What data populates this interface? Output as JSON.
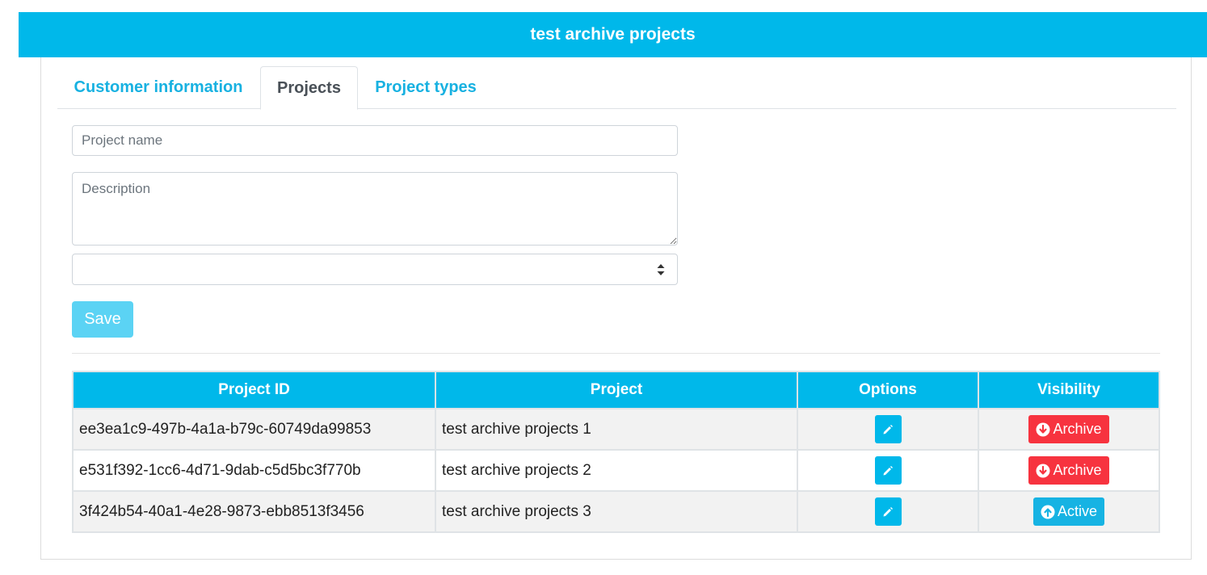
{
  "header": {
    "title": "test archive projects"
  },
  "tabs": [
    {
      "label": "Customer information",
      "active": false
    },
    {
      "label": "Projects",
      "active": true
    },
    {
      "label": "Project types",
      "active": false
    }
  ],
  "form": {
    "project_name_placeholder": "Project name",
    "description_placeholder": "Description",
    "project_type_value": "",
    "save_label": "Save"
  },
  "table": {
    "headers": [
      "Project ID",
      "Project",
      "Options",
      "Visibility"
    ],
    "rows": [
      {
        "id": "ee3ea1c9-497b-4a1a-b79c-60749da99853",
        "project": "test archive projects 1",
        "visibility": "Archive",
        "visibility_icon": "arrow-down-circle-icon",
        "visibility_color": "#f7333f"
      },
      {
        "id": "e531f392-1cc6-4d71-9dab-c5d5bc3f770b",
        "project": "test archive projects 2",
        "visibility": "Archive",
        "visibility_icon": "arrow-down-circle-icon",
        "visibility_color": "#f7333f"
      },
      {
        "id": "3f424b54-40a1-4e28-9873-ebb8513f3456",
        "project": "test archive projects 3",
        "visibility": "Active",
        "visibility_icon": "arrow-up-circle-icon",
        "visibility_color": "#16b3e3"
      }
    ],
    "options_icon": "pencil-icon"
  },
  "colors": {
    "accent": "#00b8ea",
    "tab_text": "#17b1e1",
    "save_button": "#5bd3f4",
    "archive": "#f7333f",
    "active": "#16b3e3"
  }
}
